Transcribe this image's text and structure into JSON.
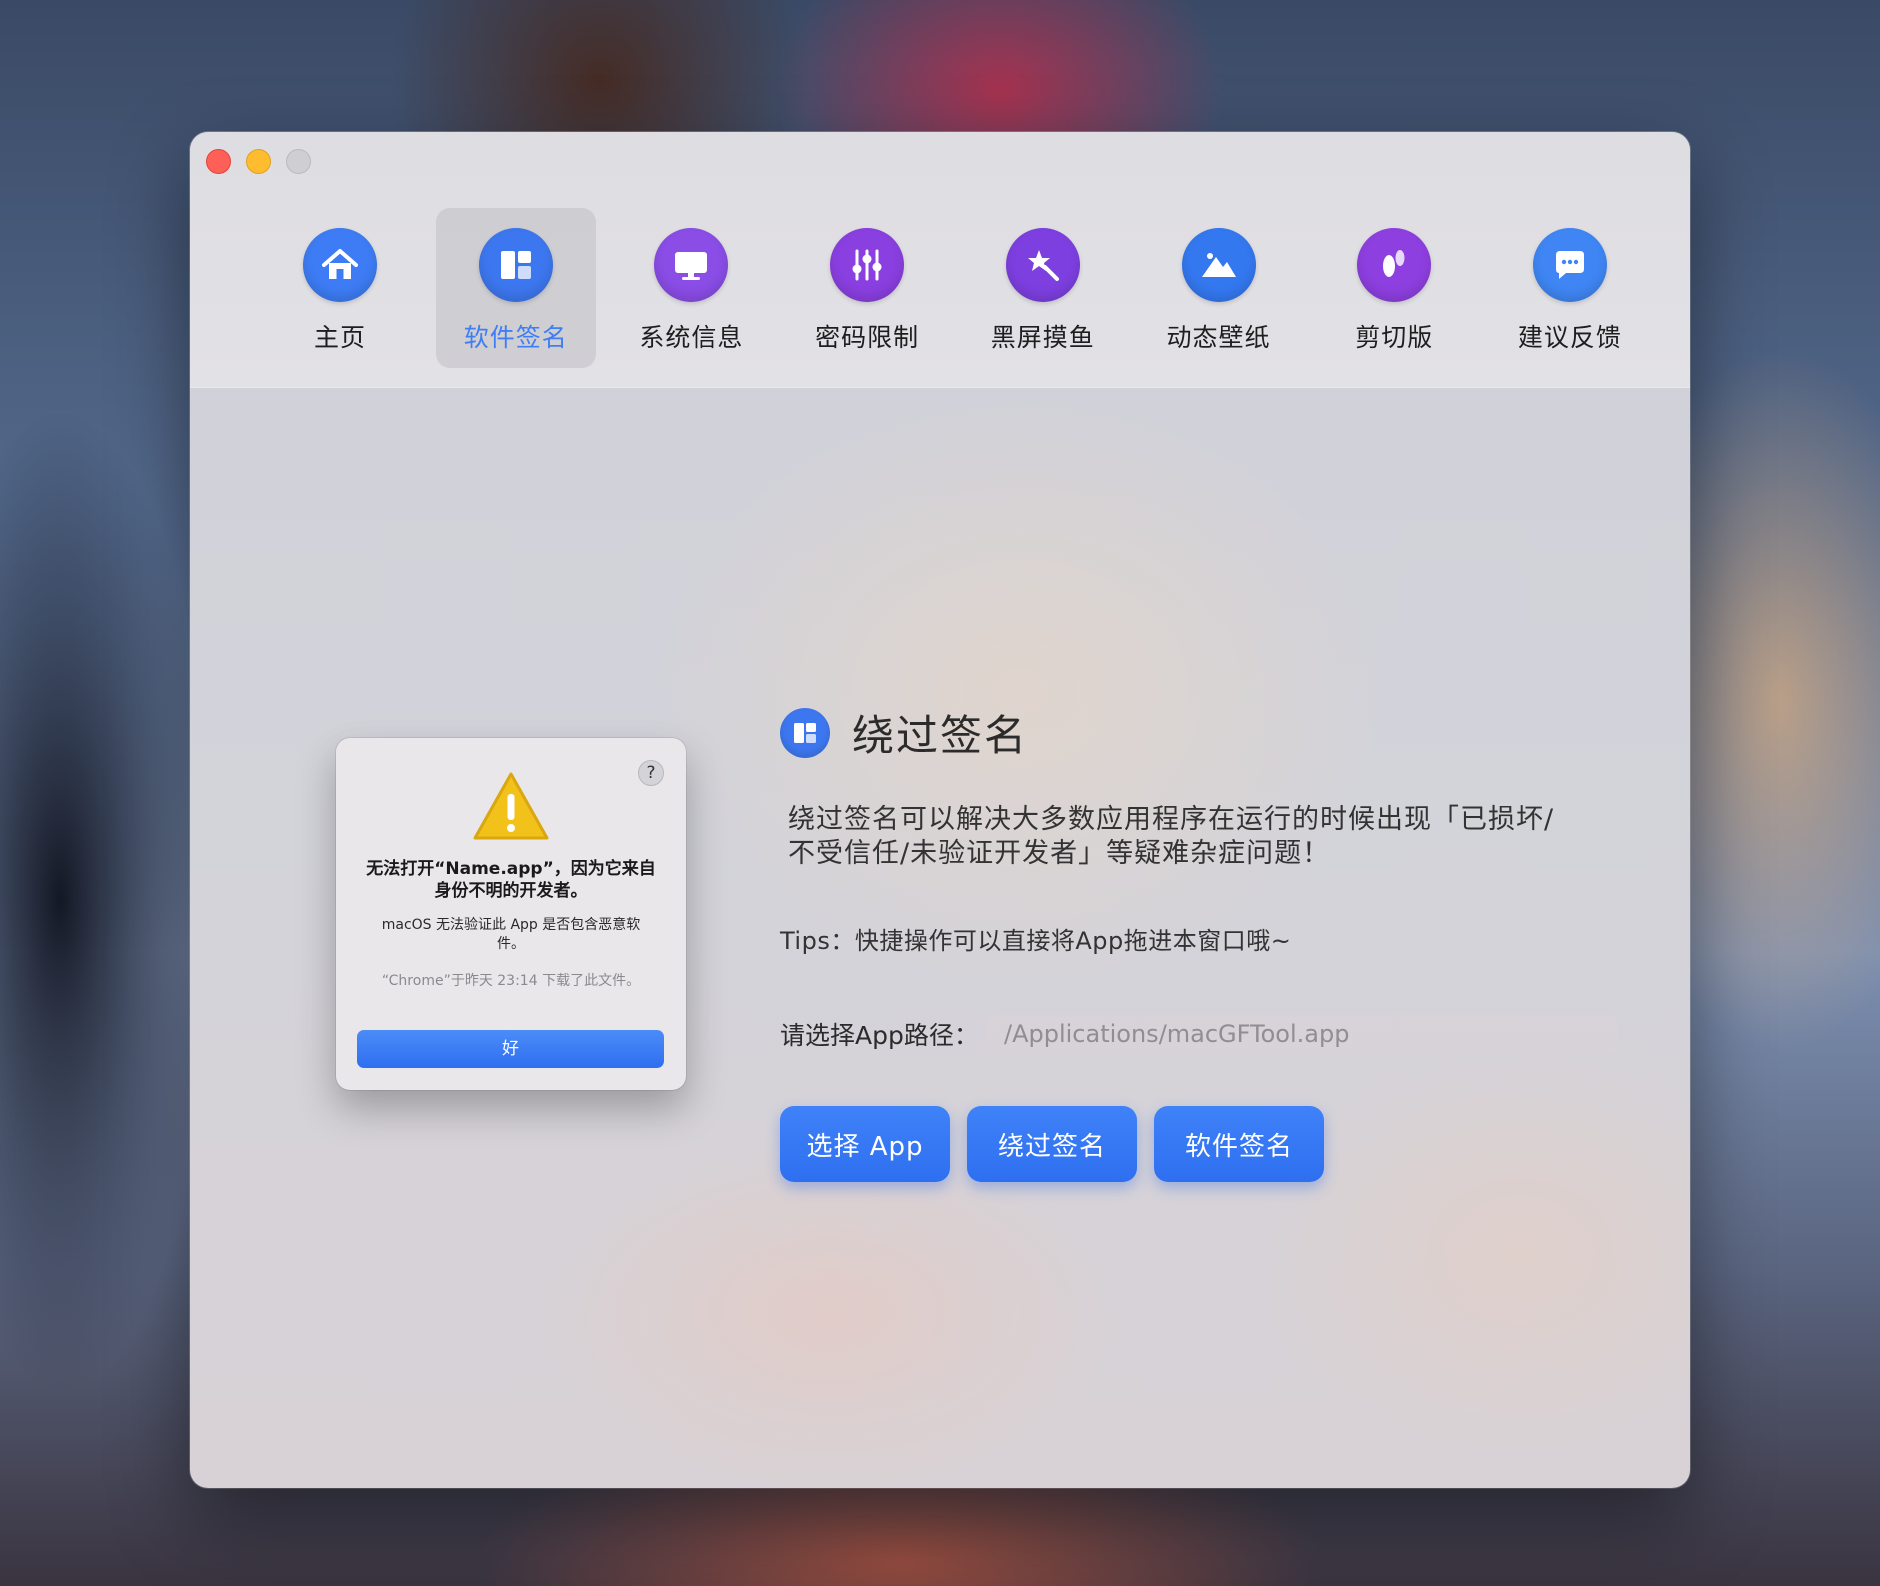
{
  "window": {
    "controls": [
      "close",
      "minimize",
      "zoom"
    ]
  },
  "tabs": [
    {
      "label": "主页",
      "icon": "home-icon",
      "color": "#3d7cf4",
      "active": false
    },
    {
      "label": "软件签名",
      "icon": "layout-icon",
      "color": "#3d77ef",
      "active": true
    },
    {
      "label": "系统信息",
      "icon": "monitor-icon",
      "color": "#8a4de6",
      "active": false
    },
    {
      "label": "密码限制",
      "icon": "sliders-icon",
      "color": "#8a3fe0",
      "active": false
    },
    {
      "label": "黑屏摸鱼",
      "icon": "magic-wand-icon",
      "color": "#7d3fe0",
      "active": false
    },
    {
      "label": "动态壁纸",
      "icon": "mountain-icon",
      "color": "#3478f0",
      "active": false
    },
    {
      "label": "剪切版",
      "icon": "footprints-icon",
      "color": "#8e3fe0",
      "active": false
    },
    {
      "label": "建议反馈",
      "icon": "chat-bubble-icon",
      "color": "#3f86f4",
      "active": false
    }
  ],
  "alert": {
    "help": "?",
    "title": "无法打开“Name.app”，因为它来自身份不明的开发者。",
    "message": "macOS 无法验证此 App 是否包含恶意软件。",
    "note": "“Chrome”于昨天 23:14 下载了此文件。",
    "ok_label": "好"
  },
  "section": {
    "title": "绕过签名",
    "description": "绕过签名可以解决大多数应用程序在运行的时候出现「已损坏/不受信任/未验证开发者」等疑难杂症问题！",
    "tips": "Tips：快捷操作可以直接将App拖进本窗口哦~",
    "path_label": "请选择App路径：",
    "path_placeholder": "/Applications/macGFTool.app"
  },
  "buttons": {
    "select": "选择 App",
    "bypass": "绕过签名",
    "sign": "软件签名"
  },
  "colors": {
    "accent": "#3f7ef5",
    "button": "#2e6ff0"
  }
}
